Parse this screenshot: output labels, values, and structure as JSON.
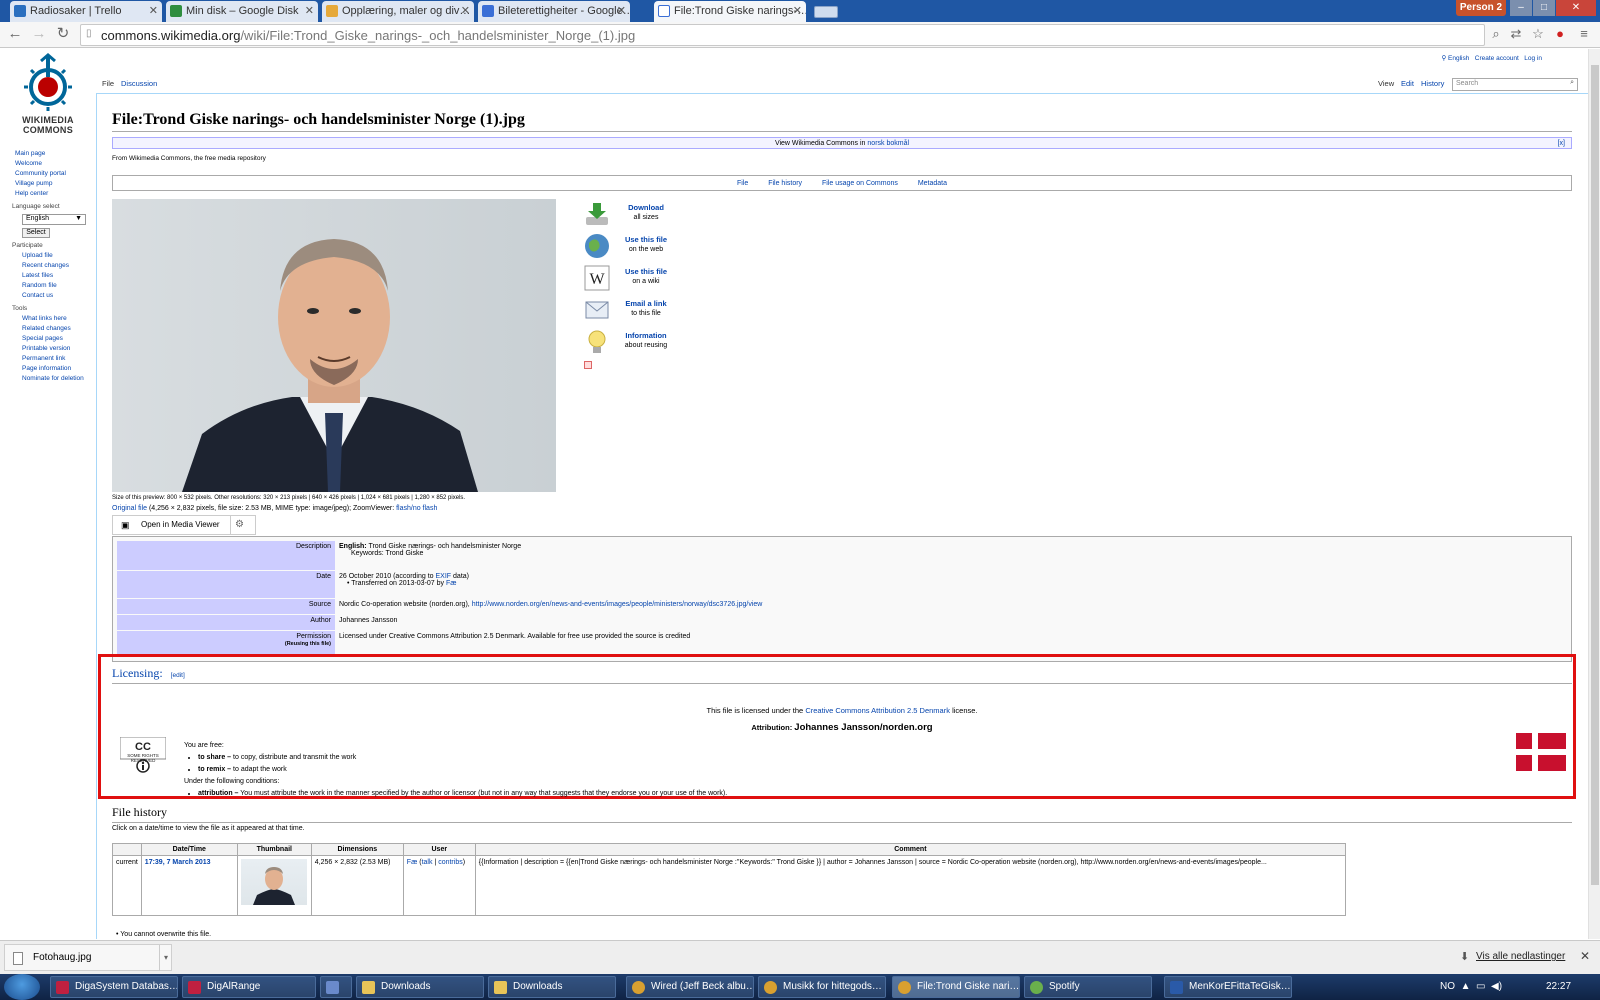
{
  "browser": {
    "tabs": [
      {
        "label": "Radiosaker | Trello",
        "color": "#2a6fbf"
      },
      {
        "label": "Min disk – Google Disk",
        "color": "#2f8e3f"
      },
      {
        "label": "Opplæring, maler og div…",
        "color": "#e6a93a"
      },
      {
        "label": "Bileterettigheiter - Google…",
        "color": "#3b6fd6"
      },
      {
        "label": "File:Trond Giske narings-…",
        "color": "#3b6fd6"
      }
    ],
    "profile": "Person 2",
    "url_domain": "commons.wikimedia.org",
    "url_path": "/wiki/File:Trond_Giske_narings-_och_handelsminister_Norge_(1).jpg"
  },
  "wiki": {
    "logo_line1": "WIKIMEDIA",
    "logo_line2": "COMMONS",
    "nav": [
      "Main page",
      "Welcome",
      "Community portal",
      "Village pump",
      "Help center"
    ],
    "language_heading": "Language select",
    "language_value": "English",
    "language_button": "Select",
    "participate_heading": "Participate",
    "participate": [
      "Upload file",
      "Recent changes",
      "Latest files",
      "Random file",
      "Contact us"
    ],
    "tools_heading": "Tools",
    "tools": [
      "What links here",
      "Related changes",
      "Special pages",
      "Printable version",
      "Permanent link",
      "Page information",
      "Nominate for deletion"
    ],
    "personal": {
      "lang": "English",
      "create": "Create account",
      "login": "Log in"
    },
    "page_tabs": {
      "file": "File",
      "discussion": "Discussion",
      "view": "View",
      "edit": "Edit",
      "history": "History"
    },
    "search_placeholder": "Search",
    "title": "File:Trond Giske narings- och handelsminister Norge (1).jpg",
    "view_bar_text": "View Wikimedia Commons in",
    "view_bar_link": "norsk bokmål",
    "view_bar_close": "[x]",
    "site_sub": "From Wikimedia Commons, the free media repository",
    "file_toc": [
      "File",
      "File history",
      "File usage on Commons",
      "Metadata"
    ],
    "actions": [
      {
        "t1": "Download",
        "t2": "all sizes"
      },
      {
        "t1": "Use this file",
        "t2": "on the web"
      },
      {
        "t1": "Use this file",
        "t2": "on a wiki"
      },
      {
        "t1": "Email a link",
        "t2": "to this file"
      },
      {
        "t1": "Information",
        "t2": "about reusing"
      }
    ],
    "preview_info": "Size of this preview: 800 × 532 pixels. Other resolutions: 320 × 213 pixels | 640 × 426 pixels | 1,024 × 681 pixels | 1,280 × 852 pixels.",
    "original_link": "Original file",
    "original_info": " (4,256 × 2,832 pixels, file size: 2.53 MB, MIME type: image/jpeg); ZoomViewer:",
    "zoom_link": "flash/no flash",
    "mmv_label": "Open in Media Viewer",
    "info": {
      "description_label": "Description",
      "description_lang": "English:",
      "description": "Trond Giske nærings- och handelsminister Norge",
      "keywords": "Keywords: Trond Giske",
      "date_label": "Date",
      "date": "26 October 2010 (according to",
      "date_exif": "EXIF",
      "date_tail": "data)",
      "transferred": "Transferred on 2013-03-07 by",
      "transferred_user": "Fæ",
      "source_label": "Source",
      "source_text": "Nordic Co-operation website (norden.org),",
      "source_url": "http://www.norden.org/en/news-and-events/images/people/ministers/norway/dsc3726.jpg/view",
      "author_label": "Author",
      "author": "Johannes Jansson",
      "permission_label": "Permission",
      "permission_sub": "(Reusing this file)",
      "permission": "Licensed under Creative Commons Attribution 2.5 Denmark. Available for free use provided the source is credited"
    },
    "licensing": {
      "heading": "Licensing:",
      "edit": "[edit]",
      "line1_pre": "This file is licensed under the",
      "line1_link": "Creative Commons Attribution 2.5 Denmark",
      "line1_post": "license.",
      "attribution_label": "Attribution:",
      "attribution": "Johannes Jansson/norden.org",
      "free": "You are free:",
      "share_b": "to share –",
      "share": "to copy, distribute and transmit the work",
      "remix_b": "to remix –",
      "remix": "to adapt the work",
      "conditions": "Under the following conditions:",
      "attr_b": "attribution –",
      "attr": "You must attribute the work in the manner specified by the author or licensor (but not in any way that suggests that they endorse you or your use of the work).",
      "cc_text": "SOME RIGHTS RESERVED"
    },
    "history": {
      "heading": "File history",
      "sub": "Click on a date/time to view the file as it appeared at that time.",
      "cols": [
        "Date/Time",
        "Thumbnail",
        "Dimensions",
        "User",
        "Comment"
      ],
      "row_status": "current",
      "row_date": "17:39, 7 March 2013",
      "row_dims": "4,256 × 2,832 (2.53 MB)",
      "row_user": "Fæ",
      "row_talk": "talk",
      "row_contribs": "contribs",
      "row_comment": "{{Information | description = {{en|Trond Giske nærings- och handelsminister Norge :''Keywords:'' Trond Giske }} | author = Johannes Jansson | source = Nordic Co-operation website (norden.org), http://www.norden.org/en/news-and-events/images/people...",
      "note": "You cannot overwrite this file."
    }
  },
  "downloads": {
    "file": "Fotohaug.jpg",
    "show_all": "Vis alle nedlastinger"
  },
  "taskbar": {
    "items": [
      "DigaSystem Databas…",
      "DigAlRange",
      "",
      "Downloads",
      "Downloads",
      "Wired (Jeff Beck albu…",
      "Musikk for hittegods…",
      "File:Trond Giske nari…",
      "Spotify",
      "MenKorEFittaTeGisk…"
    ],
    "lang": "NO",
    "time": "22:27"
  }
}
